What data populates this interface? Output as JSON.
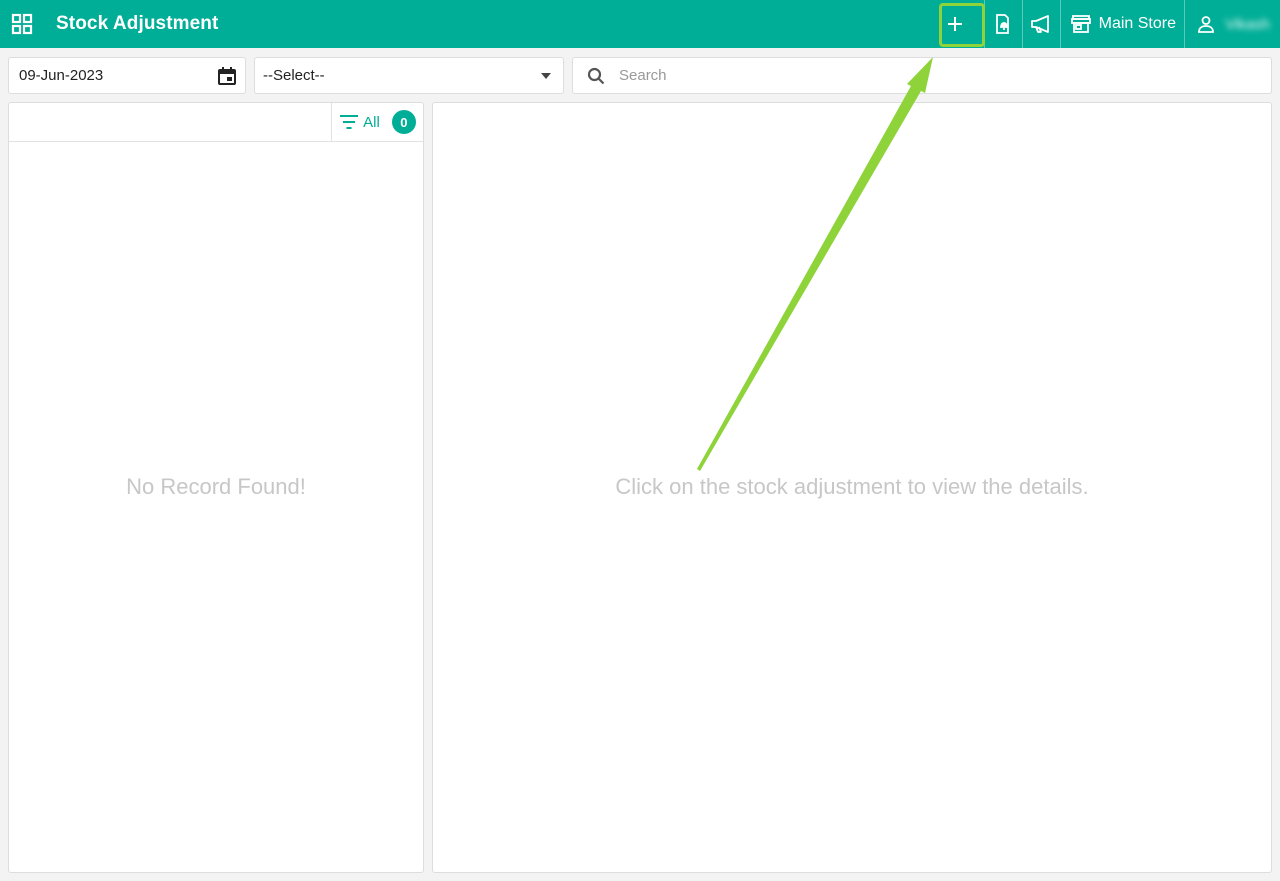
{
  "header": {
    "title": "Stock Adjustment",
    "store_label": "Main Store",
    "user_name": "Vikash",
    "icons": [
      "apps-grid-icon",
      "plus-icon",
      "mobile-bell-icon",
      "megaphone-icon",
      "store-icon",
      "user-icon"
    ]
  },
  "filters": {
    "date_value": "09-Jun-2023",
    "select_value": "--Select--",
    "search_placeholder": "Search"
  },
  "list_panel": {
    "filter_label": "All",
    "count": "0",
    "empty_text": "No Record Found!"
  },
  "detail_panel": {
    "hint_text": "Click on the stock adjustment to view the details."
  },
  "colors": {
    "primary": "#00ae97",
    "highlight": "#8fd33a"
  }
}
